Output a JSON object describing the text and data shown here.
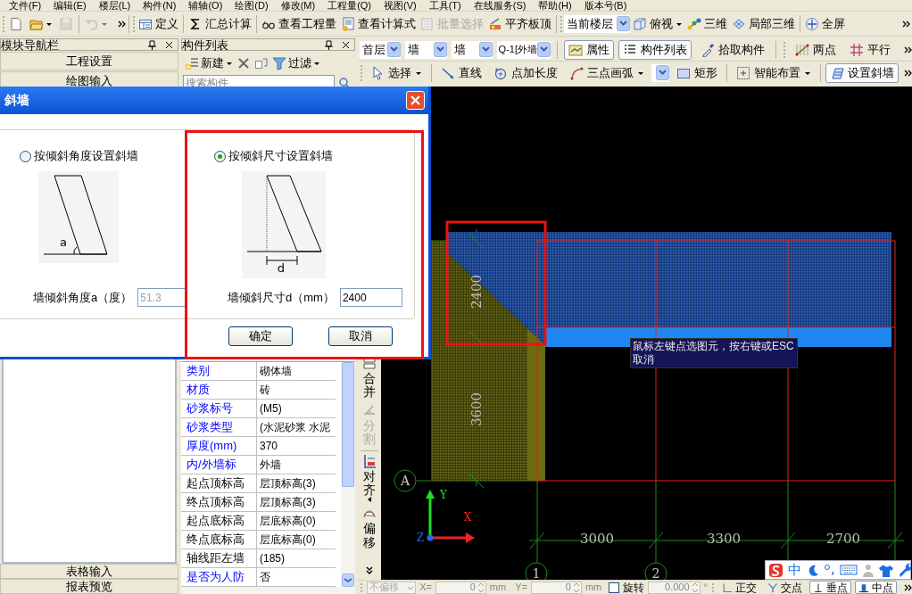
{
  "menu_bar": [
    "文件(F)",
    "编辑(E)",
    "楼层(L)",
    "构件(N)",
    "辅轴(O)",
    "绘图(D)",
    "修改(M)",
    "工程量(Q)",
    "视图(V)",
    "工具(T)",
    "在线服务(S)",
    "帮助(H)",
    "版本号(B)"
  ],
  "main_toolbar": {
    "file_buttons": [
      {
        "disabled": false,
        "dropdown": false
      },
      {
        "disabled": false,
        "dropdown": true
      },
      {
        "disabled": true,
        "dropdown": false
      },
      {
        "disabled": true,
        "dropdown": true
      }
    ],
    "buttons": [
      {
        "label": "定义",
        "disabled": false
      },
      {
        "label": "汇总计算",
        "disabled": false
      },
      {
        "label": "查看工程量",
        "disabled": false
      },
      {
        "label": "查看计算式",
        "disabled": false
      },
      {
        "label": "批量选择",
        "disabled": true
      },
      {
        "label": "平齐板顶",
        "disabled": false
      }
    ],
    "floor_scope": "当前楼层",
    "view_buttons": [
      {
        "label": "俯视",
        "dropdown": true
      },
      {
        "label": "三维",
        "dropdown": false
      },
      {
        "label": "局部三维",
        "dropdown": false
      },
      {
        "label": "全屏",
        "dropdown": false
      }
    ]
  },
  "module_nav": {
    "title": "模块导航栏",
    "top_sections": [
      "工程设置",
      "绘图输入"
    ],
    "bottom_sections": [
      "表格输入",
      "报表预览"
    ]
  },
  "component_list": {
    "title": "构件列表",
    "toolbar": [
      {
        "label": "新建",
        "dropdown": true
      },
      {
        "label": "过滤",
        "dropdown": true
      }
    ],
    "search": {
      "placeholder": "搜索构件"
    }
  },
  "properties": [
    {
      "name": "类别",
      "value": "砌体墙",
      "public": true
    },
    {
      "name": "材质",
      "value": "砖",
      "public": true
    },
    {
      "name": "砂浆标号",
      "value": "(M5)",
      "public": true
    },
    {
      "name": "砂浆类型",
      "value": "(水泥砂浆 水泥",
      "public": true
    },
    {
      "name": "厚度(mm)",
      "value": "370",
      "public": true
    },
    {
      "name": "内/外墙标",
      "value": "外墙",
      "public": true
    },
    {
      "name": "起点顶标高",
      "value": "层顶标高(3)",
      "public": false
    },
    {
      "name": "终点顶标高",
      "value": "层顶标高(3)",
      "public": false
    },
    {
      "name": "起点底标高",
      "value": "层底标高(0)",
      "public": false
    },
    {
      "name": "终点底标高",
      "value": "层底标高(0)",
      "public": false
    },
    {
      "name": "轴线距左墙",
      "value": "(185)",
      "public": false
    },
    {
      "name": "是否为人防",
      "value": "否",
      "public": true
    }
  ],
  "draw_toolbar": {
    "selectors": [
      "首层",
      "墙",
      "墙",
      "Q-1[外墙"
    ],
    "panel_buttons": [
      {
        "label": "属性",
        "pressed": true
      },
      {
        "label": "构件列表",
        "pressed": true
      },
      {
        "label": "拾取构件",
        "pressed": false
      },
      {
        "label": "两点",
        "pressed": false
      },
      {
        "label": "平行",
        "pressed": false
      }
    ],
    "draw_buttons": [
      {
        "label": "选择",
        "dropdown": true,
        "pressed": false
      },
      {
        "label": "直线",
        "dropdown": false,
        "pressed": false
      },
      {
        "label": "点加长度",
        "dropdown": false,
        "pressed": false
      },
      {
        "label": "三点画弧",
        "dropdown": true,
        "pressed": false
      },
      {
        "label": "矩形",
        "dropdown": false,
        "pressed": false
      },
      {
        "label": "智能布置",
        "dropdown": true,
        "pressed": false
      },
      {
        "label": "设置斜墙",
        "dropdown": false,
        "pressed": true
      }
    ]
  },
  "side_toolbar": [
    {
      "label": "合并",
      "disabled": false
    },
    {
      "label": "分割",
      "disabled": true
    },
    {
      "label": "对齐",
      "disabled": false
    },
    {
      "label": "偏移",
      "disabled": false
    }
  ],
  "canvas": {
    "vertical_dimensions": [
      "2400",
      "3600"
    ],
    "horizontal_dimensions": [
      "3000",
      "3300",
      "2700"
    ],
    "axis_labels": [
      "A",
      "1",
      "2"
    ],
    "ucs_letters": [
      "Y",
      "X",
      "Z"
    ],
    "tooltip": "鼠标左键点选图元，按右键或ESC取消"
  },
  "ime_bar": {
    "mode": "中"
  },
  "status_bar": {
    "offset_mode": "不偏移",
    "x_label": "X=",
    "x_value": "0",
    "x_unit": "mm",
    "y_label": "Y=",
    "y_value": "0",
    "y_unit": "mm",
    "rotate": {
      "label": "旋转",
      "checked": false
    },
    "angle": "0.000",
    "angle_unit": "°",
    "snaps": [
      {
        "label": "正交",
        "pressed": false
      },
      {
        "label": "交点",
        "pressed": false
      },
      {
        "label": "垂点",
        "pressed": true
      },
      {
        "label": "中点",
        "pressed": true
      }
    ]
  },
  "dialog": {
    "title": "斜墙",
    "options": [
      {
        "label": "按倾斜角度设置斜墙",
        "selected": false,
        "figure_label": "a",
        "field_label": "墙倾斜角度a（度）",
        "value": "51.3"
      },
      {
        "label": "按倾斜尺寸设置斜墙",
        "selected": true,
        "figure_label": "d",
        "field_label": "墙倾斜尺寸d（mm）",
        "value": "2400"
      }
    ],
    "buttons": [
      "确定",
      "取消"
    ]
  }
}
